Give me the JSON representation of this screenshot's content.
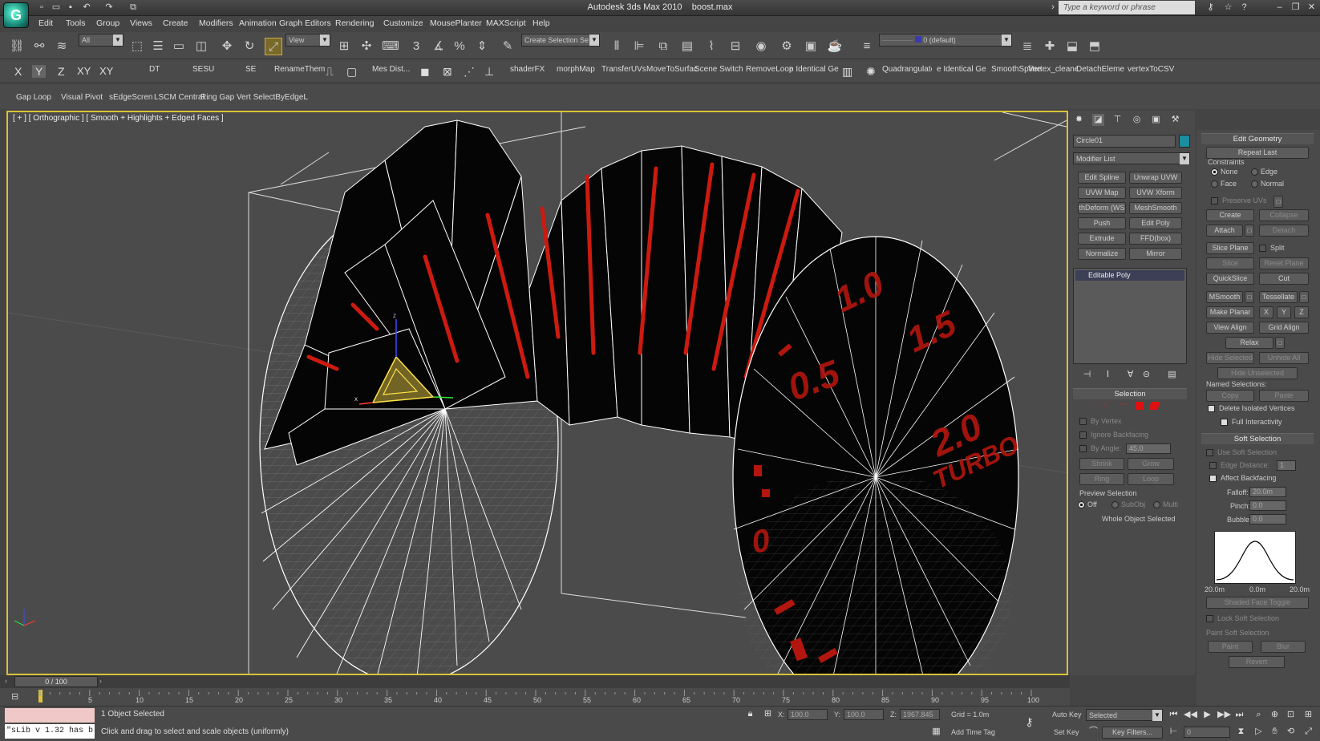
{
  "app": {
    "title": "Autodesk 3ds Max  2010",
    "file": "boost.max",
    "logo": "G",
    "help_placeholder": "Type a keyword or phrase"
  },
  "menu": [
    "Edit",
    "Tools",
    "Group",
    "Views",
    "Create",
    "Modifiers",
    "Animation",
    "Graph Editors",
    "Rendering",
    "Customize",
    "MousePlanter",
    "MAXScript",
    "Help"
  ],
  "toolbar1": {
    "filter": "All",
    "refcoord": "View",
    "selection_set": "Create Selection Se",
    "layer": "0 (default)",
    "snap_label": "3",
    "angle_snap": "%"
  },
  "toolbar2": {
    "axes": [
      "X",
      "Y",
      "Z",
      "XY",
      "XY"
    ],
    "scripts": [
      "DT",
      "SESU",
      "SE",
      "RenameThem",
      "Mes Dist...",
      "shaderFX",
      "morphMap",
      "TransferUVs",
      "MoveToSurfac",
      "Scene Switche",
      "RemoveLoop",
      "e Identical Ge",
      "Quadrangulate",
      "e Identical Ge",
      "SmoothSpline",
      "Vertex_cleane",
      "DetachElement",
      "vertexToCSV"
    ]
  },
  "toolbar3": [
    "Gap Loop",
    "Visual Pivot",
    "sEdgeScren",
    "LSCM Central",
    "Ring Gap Vert SelectByEdgeL"
  ],
  "viewport": {
    "label": "[ + ] [ Orthographic ] [ Smooth + Highlights + Edged Faces ]",
    "texture_text": [
      "1.0",
      "1.5",
      "0.5",
      "2.0",
      "TURBO",
      "0"
    ]
  },
  "command_panel": {
    "object_name": "Circle01",
    "object_color": "#1a8ea0",
    "modifier_list": "Modifier List",
    "modifier_buttons": [
      [
        "Edit Spline",
        "Unwrap UVW"
      ],
      [
        "UVW Map",
        "UVW Xform"
      ],
      [
        "thDeform (WS",
        "MeshSmooth"
      ],
      [
        "Push",
        "Edit Poly"
      ],
      [
        "Extrude",
        "FFD(box)"
      ],
      [
        "Normalize Spl.",
        "Mirror"
      ]
    ],
    "stack": [
      "Editable Poly"
    ],
    "selection": {
      "title": "Selection",
      "by_vertex": "By Vertex",
      "ignore_backfacing": "Ignore Backfacing",
      "by_angle": "By Angle:",
      "angle_value": "45.0",
      "shrink": "Shrink",
      "grow": "Grow",
      "ring": "Ring",
      "loop": "Loop",
      "preview": "Preview Selection",
      "preview_opts": [
        "Off",
        "SubObj",
        "Multi"
      ],
      "status": "Whole Object Selected"
    }
  },
  "edit_geometry": {
    "title": "Edit Geometry",
    "repeat_last": "Repeat Last",
    "constraints": "Constraints",
    "constraint_opts": [
      "None",
      "Edge",
      "Face",
      "Normal"
    ],
    "preserve_uvs": "Preserve UVs",
    "create": "Create",
    "collapse": "Collapse",
    "attach": "Attach",
    "detach": "Detach",
    "slice_plane": "Slice Plane",
    "split": "Split",
    "slice": "Slice",
    "reset_plane": "Reset Plane",
    "quickslice": "QuickSlice",
    "cut": "Cut",
    "msmooth": "MSmooth",
    "tessellate": "Tessellate",
    "make_planar": "Make Planar",
    "xyz": [
      "X",
      "Y",
      "Z"
    ],
    "view_align": "View Align",
    "grid_align": "Grid Align",
    "relax": "Relax",
    "hide_selected": "Hide Selected",
    "unhide_all": "Unhide All",
    "hide_unselected": "Hide Unselected",
    "named_selections": "Named Selections:",
    "copy": "Copy",
    "paste": "Paste",
    "delete_isolated": "Delete Isolated Vertices",
    "full_interactivity": "Full Interactivity"
  },
  "soft_selection": {
    "title": "Soft Selection",
    "use": "Use Soft Selection",
    "edge_distance": "Edge Distance:",
    "edge_value": "1",
    "affect_backfacing": "Affect Backfacing",
    "falloff": "Falloff:",
    "falloff_value": "20.0m",
    "pinch": "Pinch:",
    "pinch_value": "0.0",
    "bubble": "Bubble:",
    "bubble_value": "0.0",
    "curve_labels": [
      "20.0m",
      "0.0m",
      "20.0m"
    ],
    "shaded_face": "Shaded Face Toggle",
    "lock": "Lock Soft Selection",
    "paint_group": "Paint Soft Selection",
    "paint": "Paint",
    "blur": "Blur",
    "revert": "Revert"
  },
  "timeline": {
    "frame": "0 / 100",
    "ticks": [
      "5",
      "10",
      "15",
      "20",
      "25",
      "30",
      "35",
      "40",
      "45",
      "50",
      "55",
      "60",
      "65",
      "70",
      "75",
      "80",
      "85",
      "90",
      "95",
      "100"
    ]
  },
  "status": {
    "script_listener": "\"sLib v 1.32 has b",
    "selected": "1 Object Selected",
    "prompt": "Click and drag to select and scale objects (uniformly)",
    "x_label": "X:",
    "x_value": "100.0",
    "y_label": "Y:",
    "y_value": "100.0",
    "z_label": "Z:",
    "z_value": "1967.845",
    "grid": "Grid = 1.0m",
    "add_time_tag": "Add Time Tag",
    "auto_key": "Auto Key",
    "set_key": "Set Key",
    "key_mode": "Selected",
    "key_filters": "Key Filters...",
    "frame_value": "0"
  }
}
